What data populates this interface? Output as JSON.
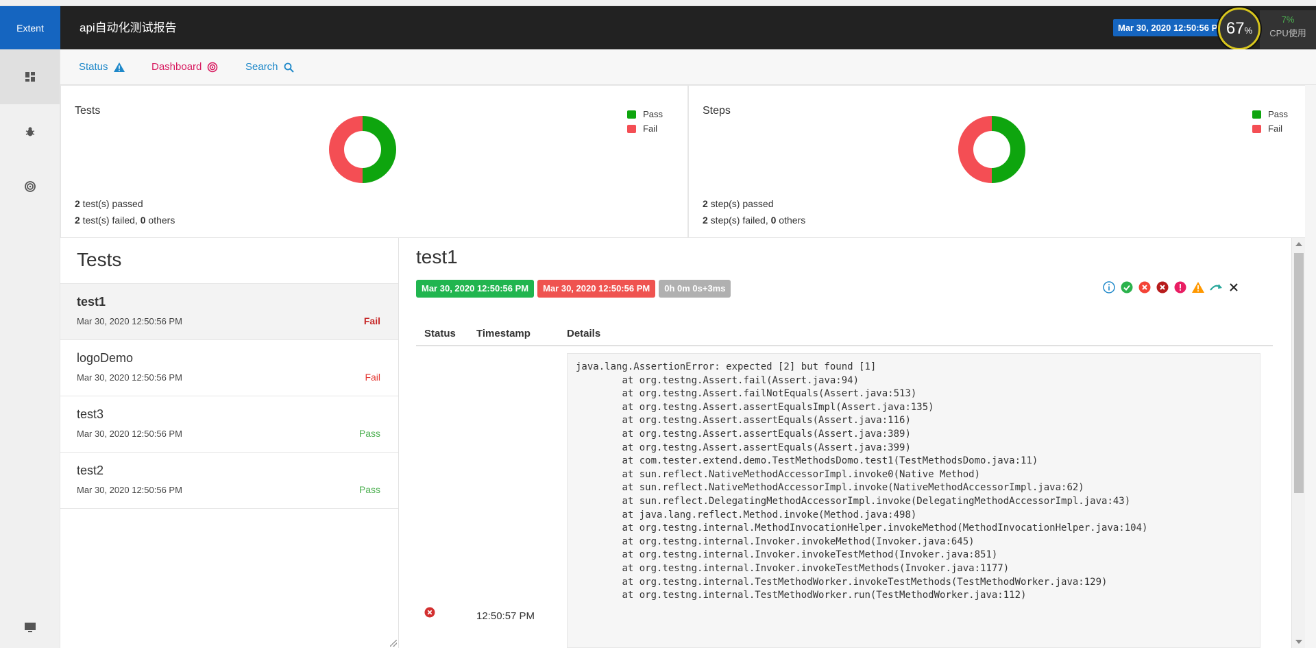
{
  "brand": "Extent",
  "report_name": "api自动化测试报告",
  "header_date": "Mar 30, 2020 12:50:56 PM",
  "cpu": {
    "value": "67",
    "unit": "%",
    "usage_pct": "7%",
    "label": "CPU使用"
  },
  "subnav": {
    "status": "Status",
    "dashboard": "Dashboard",
    "search": "Search"
  },
  "colors": {
    "pass": "#0ea50e",
    "fail": "#f44e54",
    "brand": "#1565c0"
  },
  "tests_card": {
    "title": "Tests",
    "legend": [
      "Pass",
      "Fail"
    ],
    "passed": "2",
    "passed_text": " test(s) passed",
    "failed": "2",
    "failed_text": " test(s) failed, ",
    "others": "0",
    "others_text": " others",
    "chart_data": {
      "type": "pie",
      "categories": [
        "Pass",
        "Fail"
      ],
      "values": [
        2,
        2
      ]
    }
  },
  "steps_card": {
    "title": "Steps",
    "legend": [
      "Pass",
      "Fail"
    ],
    "passed": "2",
    "passed_text": " step(s) passed",
    "failed": "2",
    "failed_text": " step(s) failed, ",
    "others": "0",
    "others_text": " others",
    "chart_data": {
      "type": "pie",
      "categories": [
        "Pass",
        "Fail"
      ],
      "values": [
        2,
        2
      ]
    }
  },
  "tests_panel": {
    "title": "Tests",
    "items": [
      {
        "name": "test1",
        "time": "Mar 30, 2020 12:50:56 PM",
        "status": "Fail"
      },
      {
        "name": "logoDemo",
        "time": "Mar 30, 2020 12:50:56 PM",
        "status": "Fail"
      },
      {
        "name": "test3",
        "time": "Mar 30, 2020 12:50:56 PM",
        "status": "Pass"
      },
      {
        "name": "test2",
        "time": "Mar 30, 2020 12:50:56 PM",
        "status": "Pass"
      }
    ]
  },
  "detail": {
    "title": "test1",
    "start": "Mar 30, 2020 12:50:56 PM",
    "end": "Mar 30, 2020 12:50:56 PM",
    "duration": "0h 0m 0s+3ms",
    "columns": [
      "Status",
      "Timestamp",
      "Details"
    ],
    "log": {
      "timestamp": "12:50:57 PM",
      "stack": "java.lang.AssertionError: expected [2] but found [1]\n\tat org.testng.Assert.fail(Assert.java:94)\n\tat org.testng.Assert.failNotEquals(Assert.java:513)\n\tat org.testng.Assert.assertEqualsImpl(Assert.java:135)\n\tat org.testng.Assert.assertEquals(Assert.java:116)\n\tat org.testng.Assert.assertEquals(Assert.java:389)\n\tat org.testng.Assert.assertEquals(Assert.java:399)\n\tat com.tester.extend.demo.TestMethodsDomo.test1(TestMethodsDomo.java:11)\n\tat sun.reflect.NativeMethodAccessorImpl.invoke0(Native Method)\n\tat sun.reflect.NativeMethodAccessorImpl.invoke(NativeMethodAccessorImpl.java:62)\n\tat sun.reflect.DelegatingMethodAccessorImpl.invoke(DelegatingMethodAccessorImpl.java:43)\n\tat java.lang.reflect.Method.invoke(Method.java:498)\n\tat org.testng.internal.MethodInvocationHelper.invokeMethod(MethodInvocationHelper.java:104)\n\tat org.testng.internal.Invoker.invokeMethod(Invoker.java:645)\n\tat org.testng.internal.Invoker.invokeTestMethod(Invoker.java:851)\n\tat org.testng.internal.Invoker.invokeTestMethods(Invoker.java:1177)\n\tat org.testng.internal.TestMethodWorker.invokeTestMethods(TestMethodWorker.java:129)\n\tat org.testng.internal.TestMethodWorker.run(TestMethodWorker.java:112)"
    },
    "filters": [
      "info-icon",
      "pass-icon",
      "fail-icon",
      "fatal-icon",
      "error-icon",
      "warning-icon",
      "skip-icon",
      "clear-filter-icon"
    ]
  }
}
